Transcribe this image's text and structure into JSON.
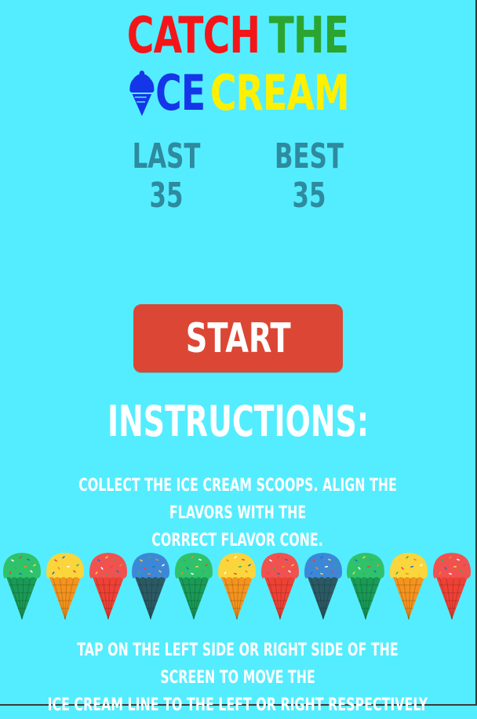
{
  "title": {
    "catch": "CATCH",
    "the": "THE",
    "ice": "CE",
    "cream": "CREAM",
    "icon": "ice-cream-cone-icon"
  },
  "scores": {
    "last_label": "LAST",
    "last_value": "35",
    "best_label": "BEST",
    "best_value": "35"
  },
  "start_button": {
    "label": "START"
  },
  "instructions": {
    "heading": "INSTRUCTIONS:",
    "collect_line1": "COLLECT THE ICE CREAM SCOOPS. ALIGN THE FLAVORS WITH THE",
    "collect_line2": "CORRECT FLAVOR CONE.",
    "tap_line1": "TAP ON THE LEFT SIDE OR RIGHT SIDE OF THE SCREEN TO MOVE THE",
    "tap_line2": "ICE CREAM LINE TO THE LEFT OR RIGHT RESPECTIVELY"
  },
  "colors": {
    "background": "#54EDFF",
    "title_red": "#F41518",
    "title_green": "#2BA52F",
    "title_blue": "#1436E8",
    "title_yellow": "#FFF000",
    "score_text": "#2E8A9E",
    "start_button": "#DB4734"
  },
  "cones": [
    {
      "flavor": "mint",
      "scoop": "#2FC26A",
      "cone": "#1A9A56"
    },
    {
      "flavor": "lemon",
      "scoop": "#FAD53B",
      "cone": "#F4931E"
    },
    {
      "flavor": "strawberry",
      "scoop": "#F0524F",
      "cone": "#EE4135"
    },
    {
      "flavor": "blueberry",
      "scoop": "#3D88D6",
      "cone": "#2C5A64"
    },
    {
      "flavor": "mint",
      "scoop": "#2FC26A",
      "cone": "#1A9A56"
    },
    {
      "flavor": "lemon",
      "scoop": "#FAD53B",
      "cone": "#F4931E"
    },
    {
      "flavor": "strawberry",
      "scoop": "#F0524F",
      "cone": "#EE4135"
    },
    {
      "flavor": "blueberry",
      "scoop": "#3D88D6",
      "cone": "#2C5A64"
    },
    {
      "flavor": "mint",
      "scoop": "#2FC26A",
      "cone": "#1A9A56"
    },
    {
      "flavor": "lemon",
      "scoop": "#FAD53B",
      "cone": "#F4931E"
    },
    {
      "flavor": "strawberry",
      "scoop": "#F0524F",
      "cone": "#EE4135"
    }
  ]
}
